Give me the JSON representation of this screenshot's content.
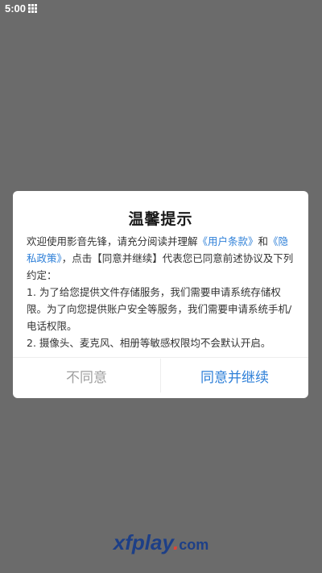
{
  "status_bar": {
    "time": "5:00",
    "icon": "grid-icon"
  },
  "dialog": {
    "title": "温馨提示",
    "intro_text_1": "欢迎使用影音先锋，请充分阅读并理解",
    "user_terms_link": "《用户条款》",
    "intro_text_2": "和",
    "privacy_link": "《隐私政策》",
    "intro_text_3": "，点击【同意并继续】代表您已同意前述协议及下列约定：",
    "item_1": " 1. 为了给您提供文件存储服务，我们需要申请系统存储权限。为了向您提供账户安全等服务，我们需要申请系统手机/电话权限。",
    "item_2": " 2. 摄像头、麦克风、相册等敏感权限均不会默认开启。",
    "decline_label": "不同意",
    "accept_label": "同意并继续"
  },
  "watermark": {
    "main": "xfplay",
    "dot": ".",
    "suffix": "com"
  },
  "colors": {
    "overlay": "#6b6b6b",
    "link": "#2f80d8",
    "decline": "#a0a0a0",
    "brand_blue": "#1d3f87",
    "brand_red": "#e34236"
  }
}
